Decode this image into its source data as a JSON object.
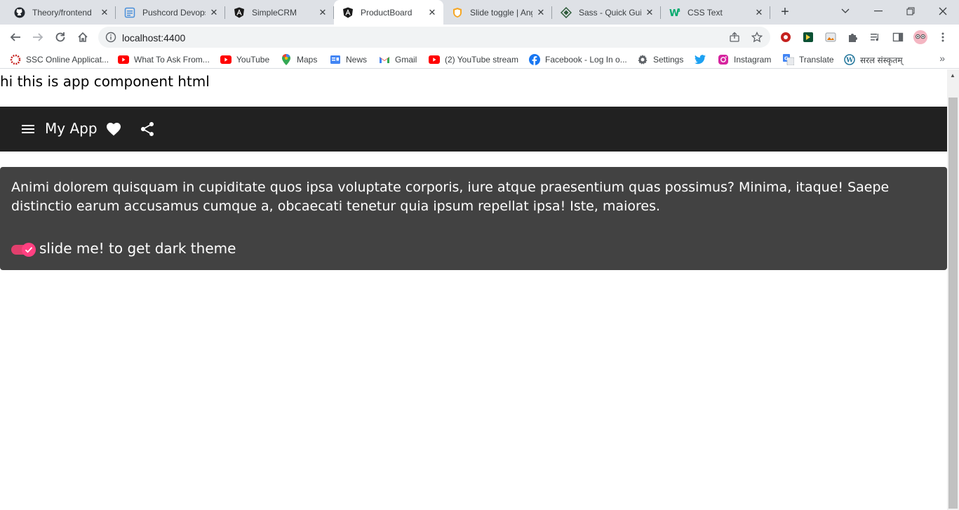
{
  "tabs": [
    {
      "title": "Theory/frontend",
      "icon": "github-icon",
      "active": false
    },
    {
      "title": "Pushcord Devops",
      "icon": "document-icon",
      "active": false
    },
    {
      "title": "SimpleCRM",
      "icon": "angular-icon",
      "active": false
    },
    {
      "title": "ProductBoard",
      "icon": "angular-icon",
      "active": true
    },
    {
      "title": "Slide toggle | Angular Material",
      "icon": "shield-icon",
      "active": false
    },
    {
      "title": "Sass - Quick Guide",
      "icon": "diamond-icon",
      "active": false
    },
    {
      "title": "CSS Text",
      "icon": "w3-icon",
      "active": false
    }
  ],
  "toolbar": {
    "url": "localhost:4400"
  },
  "bookmarks": [
    {
      "label": "SSC Online Applicat...",
      "icon": "ssc-icon"
    },
    {
      "label": "What To Ask From...",
      "icon": "youtube-icon"
    },
    {
      "label": "YouTube",
      "icon": "youtube-icon"
    },
    {
      "label": "Maps",
      "icon": "maps-icon"
    },
    {
      "label": "News",
      "icon": "news-icon"
    },
    {
      "label": "Gmail",
      "icon": "gmail-icon"
    },
    {
      "label": "(2) YouTube stream",
      "icon": "youtube-icon"
    },
    {
      "label": "Facebook - Log In o...",
      "icon": "facebook-icon"
    },
    {
      "label": "Settings",
      "icon": "gear-icon"
    },
    {
      "label": "",
      "icon": "twitter-icon"
    },
    {
      "label": "Instagram",
      "icon": "instagram-icon"
    },
    {
      "label": "Translate",
      "icon": "translate-icon"
    },
    {
      "label": "सरल संस्कृतम्",
      "icon": "wordpress-icon"
    }
  ],
  "page": {
    "hello": "hi this is app component html",
    "app_title": "My App",
    "card_text": "Animi dolorem quisquam in cupiditate quos ipsa voluptate corporis, iure atque praesentium quas possimus? Minima, itaque! Saepe distinctio earum accusamus cumque a, obcaecati tenetur quia ipsum repellat ipsa! Iste, maiores.",
    "toggle_label": "slide me! to get dark theme",
    "toggle_checked": true
  },
  "colors": {
    "appbar": "#212121",
    "card": "#424242",
    "toggle_accent": "#ff4081"
  }
}
